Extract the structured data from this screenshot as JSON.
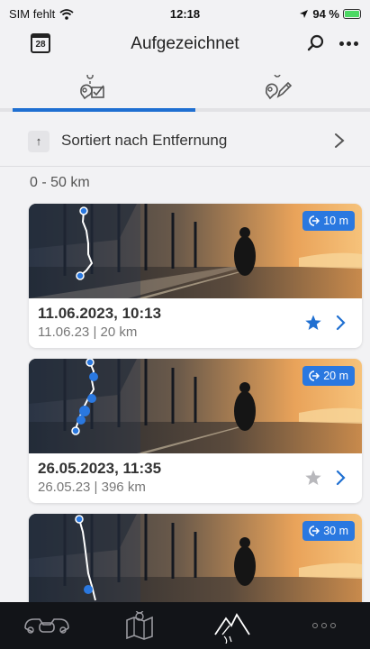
{
  "status_bar": {
    "carrier": "SIM fehlt",
    "time": "12:18",
    "battery_percent": "94 %",
    "icons": [
      "wifi-icon",
      "location-arrow-icon",
      "battery-charging-icon"
    ]
  },
  "header": {
    "calendar_day": "28",
    "title": "Aufgezeichnet",
    "icons": [
      "calendar-icon",
      "search-icon",
      "more-icon"
    ]
  },
  "tabs": [
    {
      "icon": "recorded-route-icon",
      "active": true
    },
    {
      "icon": "planned-route-icon",
      "active": false
    }
  ],
  "sort": {
    "arrow": "↑",
    "label": "Sortiert nach Entfernung"
  },
  "section": {
    "label": "0 - 50 km"
  },
  "trips": [
    {
      "badge": "10 m",
      "date": "11.06.2023, 10:13",
      "meta": "11.06.23 | 20 km",
      "favorite": true
    },
    {
      "badge": "20 m",
      "date": "26.05.2023, 11:35",
      "meta": "26.05.23 | 396 km",
      "favorite": false
    },
    {
      "badge": "30 m",
      "date": "",
      "meta": "",
      "favorite": false
    }
  ],
  "bottom_nav": [
    {
      "icon": "motorcycle-icon"
    },
    {
      "icon": "map-icon"
    },
    {
      "icon": "mountains-icon",
      "active": true
    },
    {
      "icon": "more-dots-icon"
    }
  ],
  "colors": {
    "accent": "#1f6fd1",
    "badge": "#2a78e0",
    "background": "#f2f2f4",
    "nav_background": "#121418"
  }
}
